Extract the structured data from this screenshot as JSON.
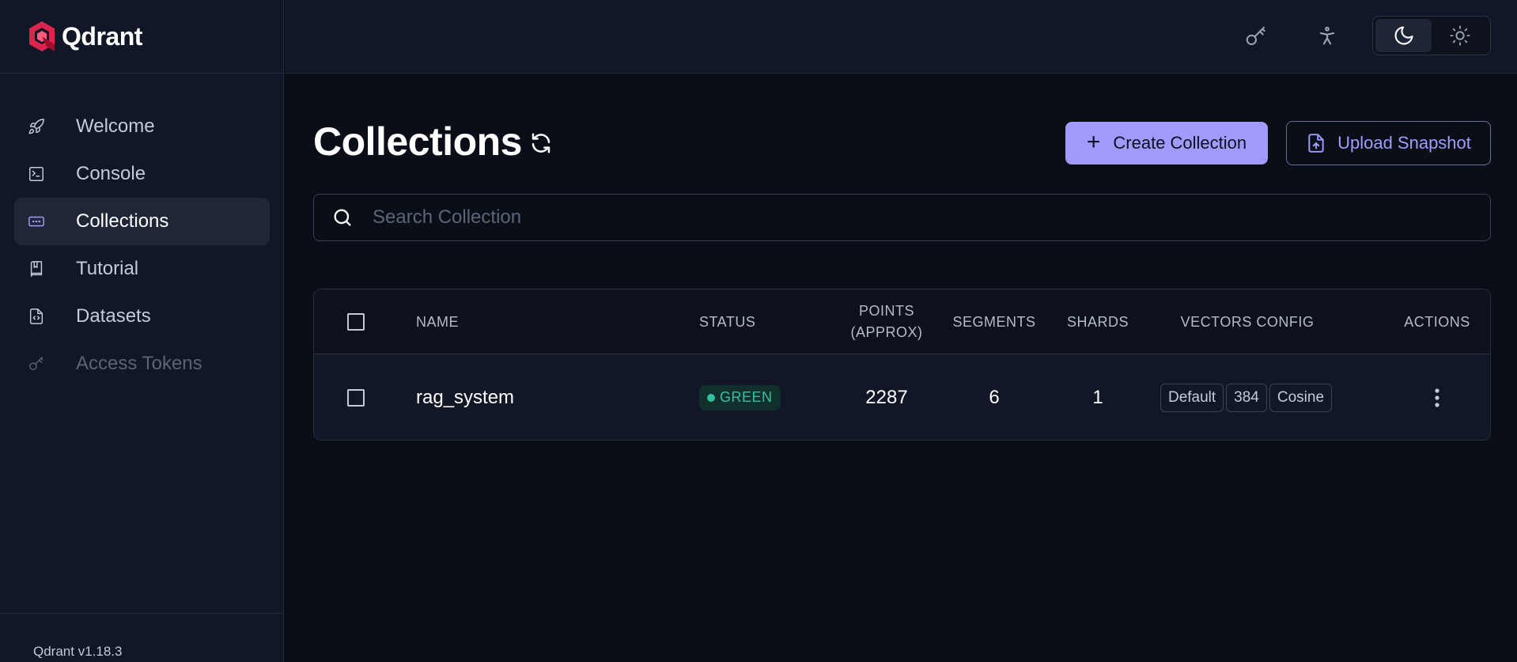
{
  "brand": {
    "name": "Qdrant",
    "version": "Qdrant v1.18.3"
  },
  "sidebar": {
    "items": [
      {
        "label": "Welcome",
        "icon": "rocket-icon",
        "state": "normal"
      },
      {
        "label": "Console",
        "icon": "terminal-icon",
        "state": "normal"
      },
      {
        "label": "Collections",
        "icon": "collections-icon",
        "state": "active"
      },
      {
        "label": "Tutorial",
        "icon": "book-icon",
        "state": "normal"
      },
      {
        "label": "Datasets",
        "icon": "file-code-icon",
        "state": "normal"
      },
      {
        "label": "Access Tokens",
        "icon": "key-icon",
        "state": "disabled"
      }
    ]
  },
  "header": {
    "icons": [
      "key-icon",
      "accessibility-icon"
    ],
    "theme": {
      "options": [
        "moon-icon",
        "sun-icon"
      ],
      "selected": "dark"
    }
  },
  "main": {
    "title": "Collections",
    "create_label": "Create Collection",
    "upload_label": "Upload Snapshot",
    "search_placeholder": "Search Collection"
  },
  "table": {
    "headers": {
      "name": "NAME",
      "status": "STATUS",
      "points_line1": "POINTS",
      "points_line2": "(APPROX)",
      "segments": "SEGMENTS",
      "shards": "SHARDS",
      "vectors": "VECTORS CONFIG",
      "actions": "ACTIONS"
    },
    "rows": [
      {
        "name": "rag_system",
        "status": "GREEN",
        "points": "2287",
        "segments": "6",
        "shards": "1",
        "vectors": [
          "Default",
          "384",
          "Cosine"
        ]
      }
    ]
  },
  "colors": {
    "accent": "#a19bfd",
    "status_green": "#34c0a0",
    "background": "#0a0e17",
    "sidebar": "#111726",
    "brand": "#dc244c"
  }
}
